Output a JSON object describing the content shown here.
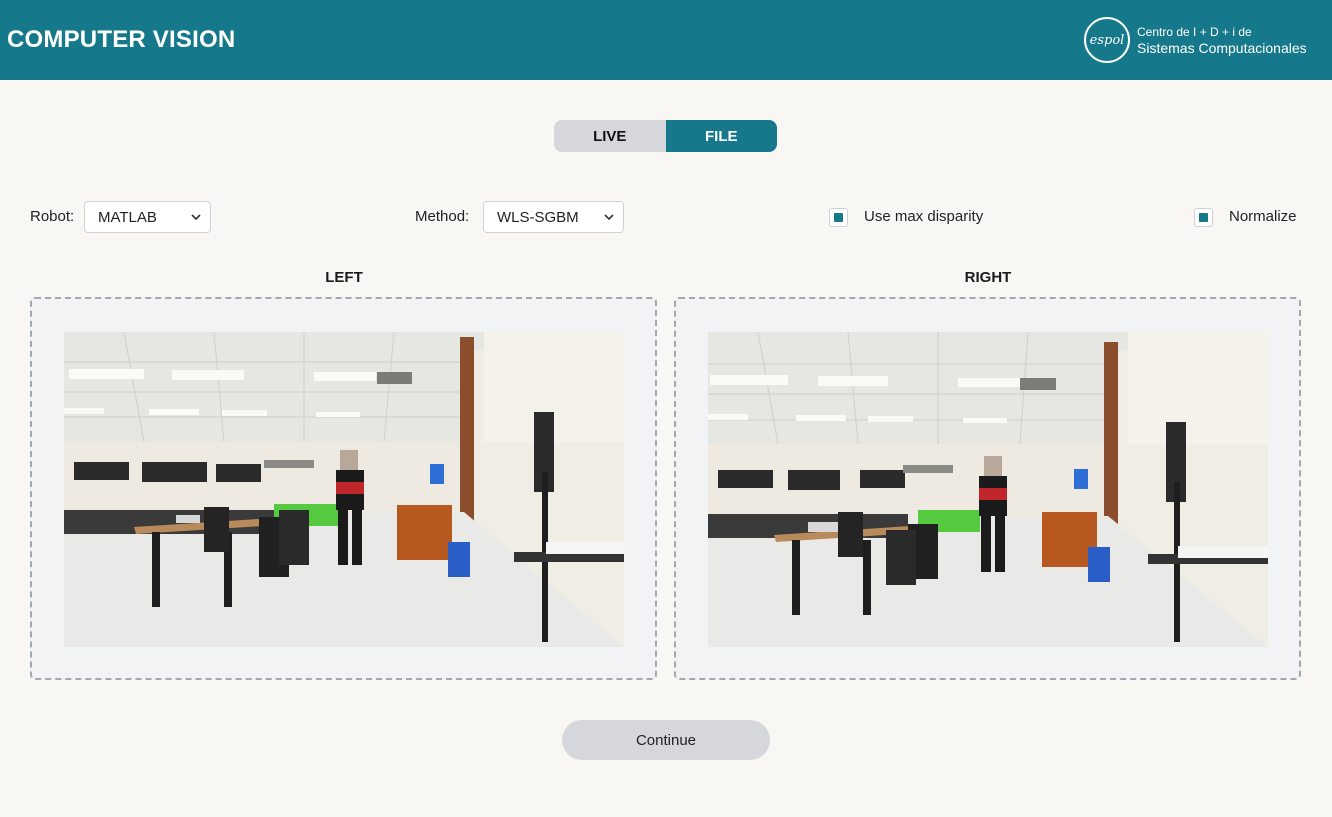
{
  "header": {
    "title": "COMPUTER VISION",
    "brand_logo_text": "espol",
    "brand_line1": "Centro de I + D + i de",
    "brand_line2": "Sistemas Computacionales"
  },
  "mode_toggle": {
    "tabs": [
      {
        "label": "LIVE",
        "active": false
      },
      {
        "label": "FILE",
        "active": true
      }
    ]
  },
  "controls": {
    "robot_label": "Robot:",
    "robot_value": "MATLAB",
    "method_label": "Method:",
    "method_value": "WLS-SGBM",
    "max_disparity_label": "Use max disparity",
    "max_disparity_checked": true,
    "normalize_label": "Normalize",
    "normalize_checked": true
  },
  "panels": {
    "left_title": "LEFT",
    "right_title": "RIGHT"
  },
  "actions": {
    "continue_label": "Continue"
  },
  "colors": {
    "accent": "#15788b",
    "button_gray": "#d5d7dc",
    "background": "#f8f7f4"
  }
}
